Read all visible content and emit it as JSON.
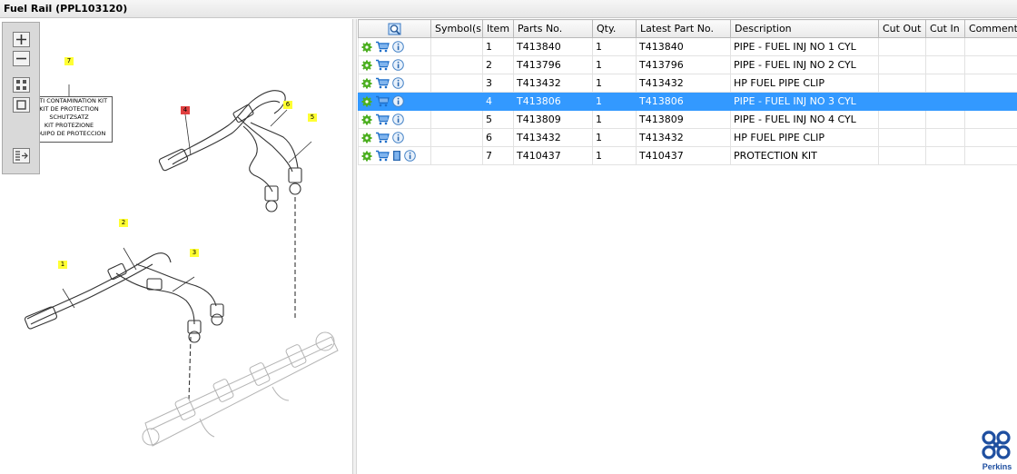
{
  "window": {
    "title": "Fuel Rail (PPL103120)"
  },
  "diagram": {
    "kit_label_lines": [
      "ANTI CONTAMINATION KIT",
      "KIT DE PROTECTION",
      "SCHUTZSATZ",
      "KIT PROTEZIONE",
      "EQUIPO DE PROTECCION"
    ],
    "callouts": [
      "1",
      "2",
      "3",
      "4",
      "5",
      "6",
      "7"
    ]
  },
  "table": {
    "columns": [
      "",
      "Symbol(s)",
      "Item",
      "Parts No.",
      "Qty.",
      "Latest Part No.",
      "Description",
      "Cut Out",
      "Cut In",
      "Comment"
    ],
    "rows": [
      {
        "item": "1",
        "part_no": "T413840",
        "qty": "1",
        "latest": "T413840",
        "description": "PIPE - FUEL INJ NO 1 CYL"
      },
      {
        "item": "2",
        "part_no": "T413796",
        "qty": "1",
        "latest": "T413796",
        "description": "PIPE - FUEL INJ NO 2 CYL"
      },
      {
        "item": "3",
        "part_no": "T413432",
        "qty": "1",
        "latest": "T413432",
        "description": "HP FUEL PIPE CLIP"
      },
      {
        "item": "4",
        "part_no": "T413806",
        "qty": "1",
        "latest": "T413806",
        "description": "PIPE - FUEL INJ NO 3 CYL"
      },
      {
        "item": "5",
        "part_no": "T413809",
        "qty": "1",
        "latest": "T413809",
        "description": "PIPE - FUEL INJ NO 4 CYL"
      },
      {
        "item": "6",
        "part_no": "T413432",
        "qty": "1",
        "latest": "T413432",
        "description": "HP FUEL PIPE CLIP"
      },
      {
        "item": "7",
        "part_no": "T410437",
        "qty": "1",
        "latest": "T410437",
        "description": "PROTECTION KIT"
      }
    ]
  },
  "brand": {
    "name": "Perkins"
  },
  "colors": {
    "selection": "#3399ff",
    "gear": "#4caf20",
    "cart": "#1f6fc9",
    "callout_yellow": "#ffff33",
    "callout_red": "#e04040"
  }
}
